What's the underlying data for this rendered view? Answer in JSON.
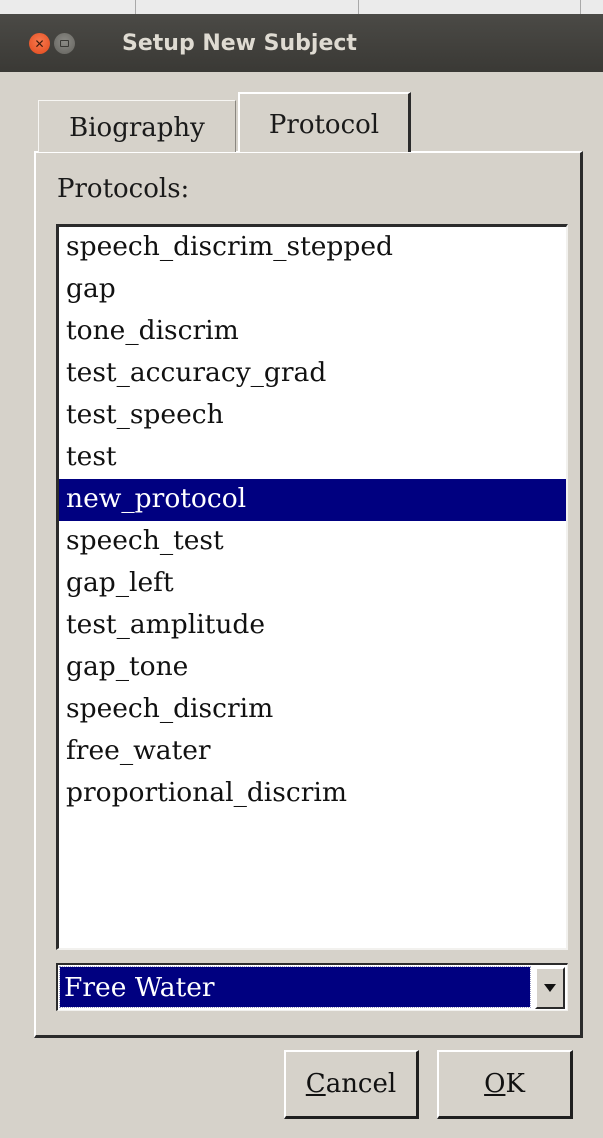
{
  "window": {
    "title": "Setup New Subject",
    "controls": {
      "close_icon": "close-icon",
      "minimize_icon": "minimize-icon"
    }
  },
  "tabs": [
    {
      "label": "Biography",
      "active": false
    },
    {
      "label": "Protocol",
      "active": true
    }
  ],
  "protocol_tab": {
    "list_label": "Protocols:",
    "protocols": [
      "speech_discrim_stepped",
      "gap",
      "tone_discrim",
      "test_accuracy_grad",
      "test_speech",
      "test",
      "new_protocol",
      "speech_test",
      "gap_left",
      "test_amplitude",
      "gap_tone",
      "speech_discrim",
      "free_water",
      "proportional_discrim"
    ],
    "selected_protocol": "new_protocol",
    "step_select": {
      "value": "Free Water"
    }
  },
  "buttons": {
    "cancel": {
      "mnemonic": "C",
      "rest": "ancel"
    },
    "ok": {
      "mnemonic": "O",
      "rest": "K"
    }
  },
  "colors": {
    "selection": "#000080",
    "dialog_background": "#d6d2ca",
    "titlebar": "#3c3b37",
    "close_button": "#e9531f"
  }
}
